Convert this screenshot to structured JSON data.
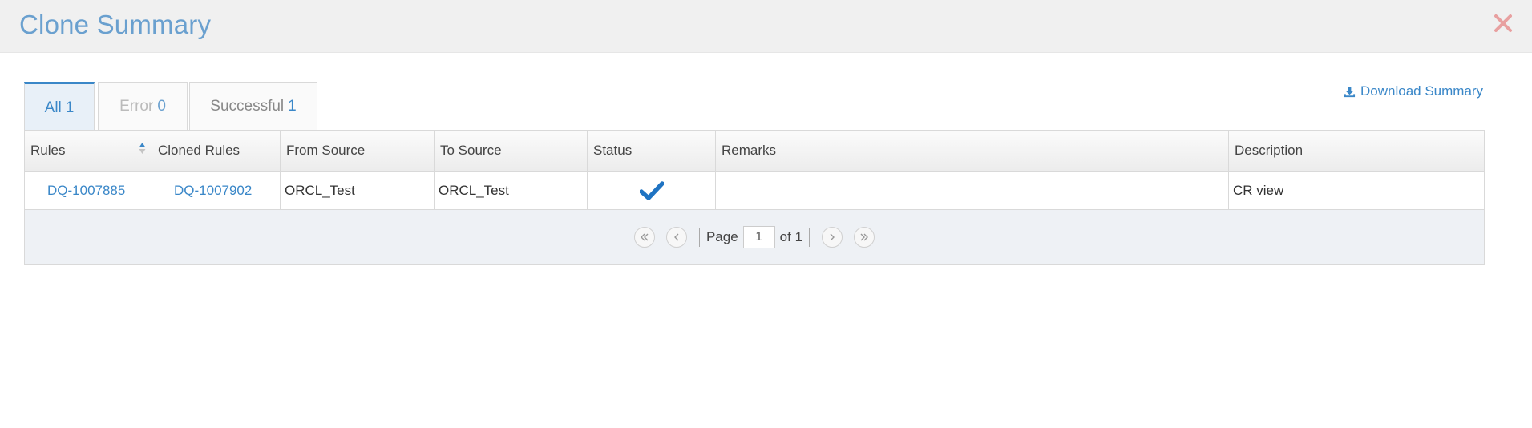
{
  "dialog": {
    "title": "Clone Summary"
  },
  "tabs": [
    {
      "label": "All",
      "count": "1"
    },
    {
      "label": "Error",
      "count": "0"
    },
    {
      "label": "Successful",
      "count": "1"
    }
  ],
  "download": {
    "label": "Download Summary"
  },
  "table": {
    "columns": [
      "Rules",
      "Cloned Rules",
      "From Source",
      "To Source",
      "Status",
      "Remarks",
      "Description"
    ],
    "rows": [
      {
        "rules": "DQ-1007885",
        "cloned_rules": "DQ-1007902",
        "from_source": "ORCL_Test",
        "to_source": "ORCL_Test",
        "status": "success",
        "remarks": "",
        "description": "CR view"
      }
    ]
  },
  "pager": {
    "page_label": "Page",
    "page_value": "1",
    "of_label": "of 1"
  },
  "colors": {
    "accent": "#3a87c8",
    "title": "#6aa0cf",
    "close": "#e8a0a0"
  },
  "icons": {
    "close": "close-icon",
    "download": "download-icon",
    "status": "checkmark-icon",
    "sort": "sort-icon"
  }
}
